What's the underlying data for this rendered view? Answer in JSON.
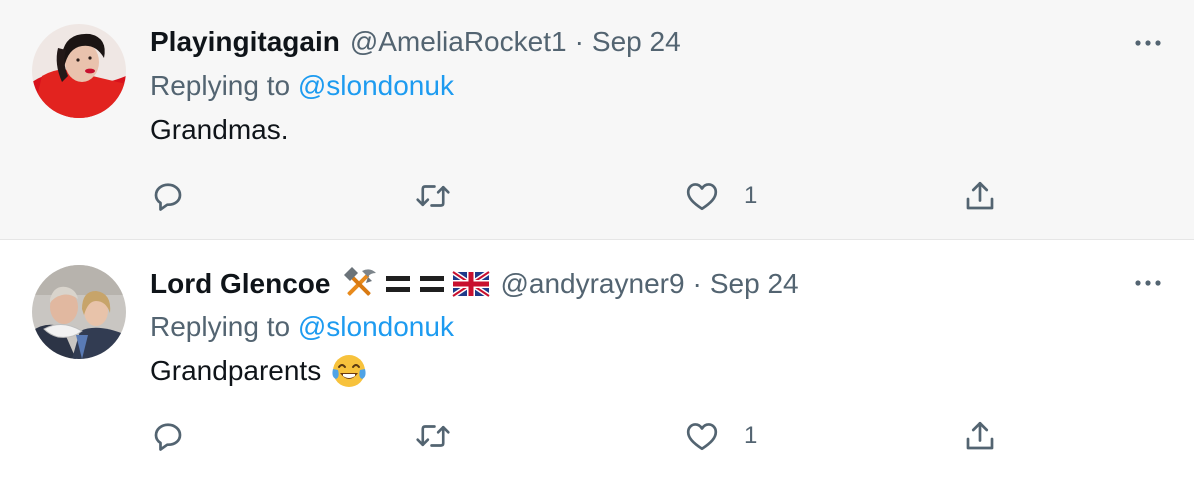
{
  "tweets": [
    {
      "author_name": "Playingitagain",
      "handle": "@AmeliaRocket1",
      "separator": "·",
      "date": "Sep 24",
      "replying_prefix": "Replying to",
      "replying_to": "@slondonuk",
      "text": "Grandmas.",
      "like_count": "1"
    },
    {
      "author_name": "Lord Glencoe",
      "name_badges": [
        "hammer-pick-emoji",
        "flag-stripe-icon",
        "flag-stripe-icon",
        "union-jack-flag-icon"
      ],
      "handle": "@andyrayner9",
      "separator": "·",
      "date": "Sep 24",
      "replying_prefix": "Replying to",
      "replying_to": "@slondonuk",
      "text": "Grandparents",
      "text_emoji": "laughing-tears-emoji",
      "like_count": "1"
    }
  ],
  "colors": {
    "link": "#1d9bf0",
    "secondary": "#536471",
    "primary": "#0f1419",
    "hover_bg": "#f7f7f7"
  }
}
